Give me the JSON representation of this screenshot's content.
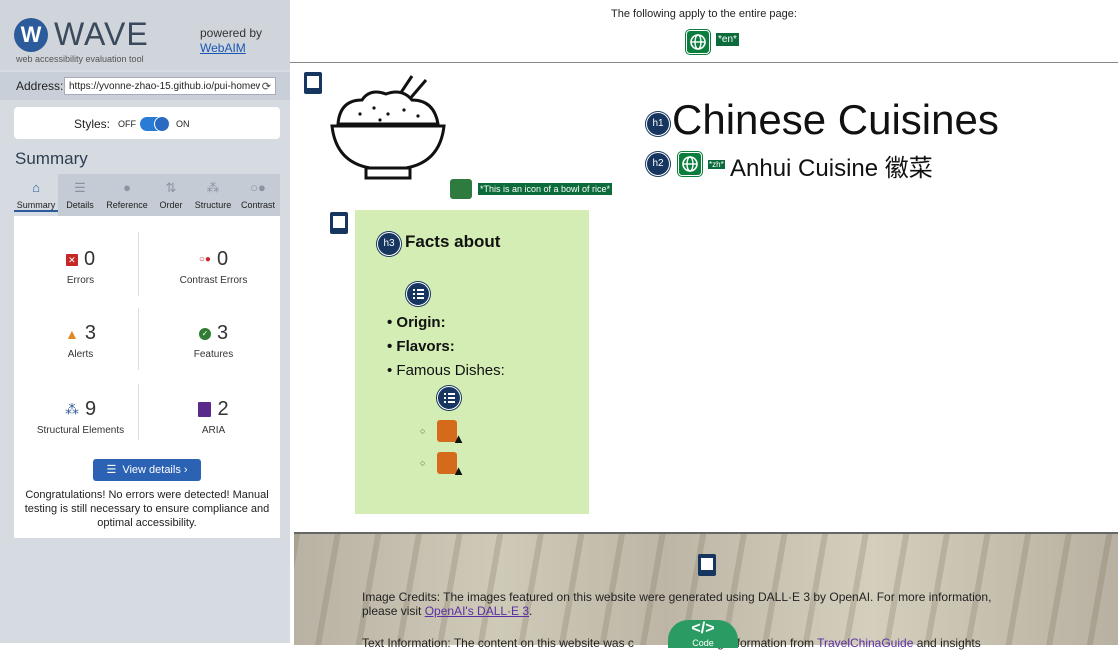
{
  "sidebar": {
    "logo": "WAVE",
    "logo_sub": "web accessibility evaluation tool",
    "powered_by": "powered by",
    "webaim_link": "WebAIM",
    "address_label": "Address:",
    "address_value": "https://yvonne-zhao-15.github.io/pui-homew",
    "styles_label": "Styles:",
    "styles_off": "OFF",
    "styles_on": "ON",
    "summary_title": "Summary",
    "tabs": [
      "Summary",
      "Details",
      "Reference",
      "Order",
      "Structure",
      "Contrast"
    ],
    "stats": {
      "errors": {
        "value": "0",
        "label": "Errors"
      },
      "contrast": {
        "value": "0",
        "label": "Contrast Errors"
      },
      "alerts": {
        "value": "3",
        "label": "Alerts"
      },
      "features": {
        "value": "3",
        "label": "Features"
      },
      "structural": {
        "value": "9",
        "label": "Structural Elements"
      },
      "aria": {
        "value": "2",
        "label": "ARIA"
      }
    },
    "view_details": "View details ›",
    "congrats": "Congratulations! No errors were detected! Manual testing is still necessary to ensure compliance and optimal accessibility."
  },
  "page": {
    "apply_text": "The following apply to the entire page:",
    "lang_tag": "*en*",
    "icon_alt": "*This is an icon of a bowl of rice*",
    "h1_badge": "h1",
    "h1": "Chinese Cuisines",
    "h2_badge": "h2",
    "zh_tag": "*zh*",
    "h2": "Anhui Cuisine 徽菜",
    "h3_badge": "h3",
    "facts_heading": "Facts about",
    "list_items": [
      "Origin:",
      "Flavors:",
      "Famous Dishes:"
    ],
    "credits_text": "Image Credits: The images featured on this website were generated using DALL·E 3 by OpenAI. For more information, please visit ",
    "credits_link": "OpenAI's DALL·E 3",
    "text_info_a": "Text Information: The content on this website was c",
    "text_info_b": "ing information from ",
    "text_info_link": "TravelChinaGuide",
    "text_info_c": " and insights",
    "code_label": "Code"
  },
  "colors": {
    "wave_blue": "#2b5b9a",
    "error_red": "#c62828",
    "alert_orange": "#e08a1e",
    "feature_green": "#2e7d32",
    "aria_purple": "#5a2a8a",
    "facts_bg": "#d3edb5"
  }
}
